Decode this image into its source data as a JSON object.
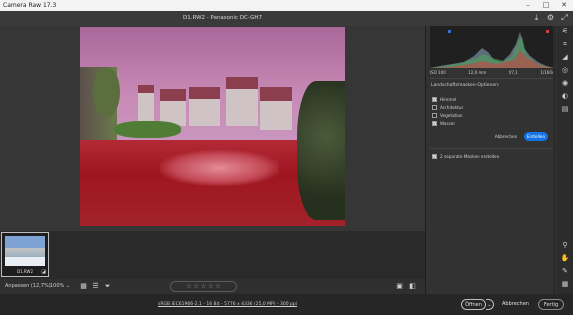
{
  "window": {
    "title": "Camera Raw 17.3",
    "controls": [
      "–",
      "□",
      "✕"
    ]
  },
  "header": {
    "filename": "D1.RW2 - Panasonic DC-GH7",
    "icons": [
      "save-icon",
      "settings-gear-icon",
      "fullscreen-icon"
    ]
  },
  "histogram": {
    "iso": "ISO 100",
    "focal": "12,0 mm",
    "aperture": "f/7,1",
    "shutter": "1/160s"
  },
  "landscape_options": {
    "title": "Landschaftsmasken-Optionen:",
    "items": [
      {
        "label": "Himmel",
        "checked": true
      },
      {
        "label": "Architektur",
        "checked": false
      },
      {
        "label": "Vegetation",
        "checked": false
      },
      {
        "label": "Wasser",
        "checked": true
      }
    ],
    "cancel_label": "Abbrechen",
    "create_label": "Erstellen",
    "separate_label": "2 separate Masken erstellen",
    "separate_checked": true
  },
  "filmstrip": {
    "thumb_label": "D1.RW2"
  },
  "bottombar": {
    "zoom_fit": "Anpassen (12,7%)",
    "zoom_percent": "100%",
    "rating_stars": "☆ ☆ ☆ ☆ ☆"
  },
  "status": {
    "meta": "sRGB IEC61966-2.1 - 16 Bit - 5776 x 4336 (25,0 MP) - 300 ppi",
    "open_label": "Öffnen",
    "cancel_label": "Abbrechen",
    "done_label": "Fertig"
  },
  "colors": {
    "accent": "#1473e6",
    "mask_red": "#a3222a",
    "mask_sky": "#c88ab6"
  }
}
